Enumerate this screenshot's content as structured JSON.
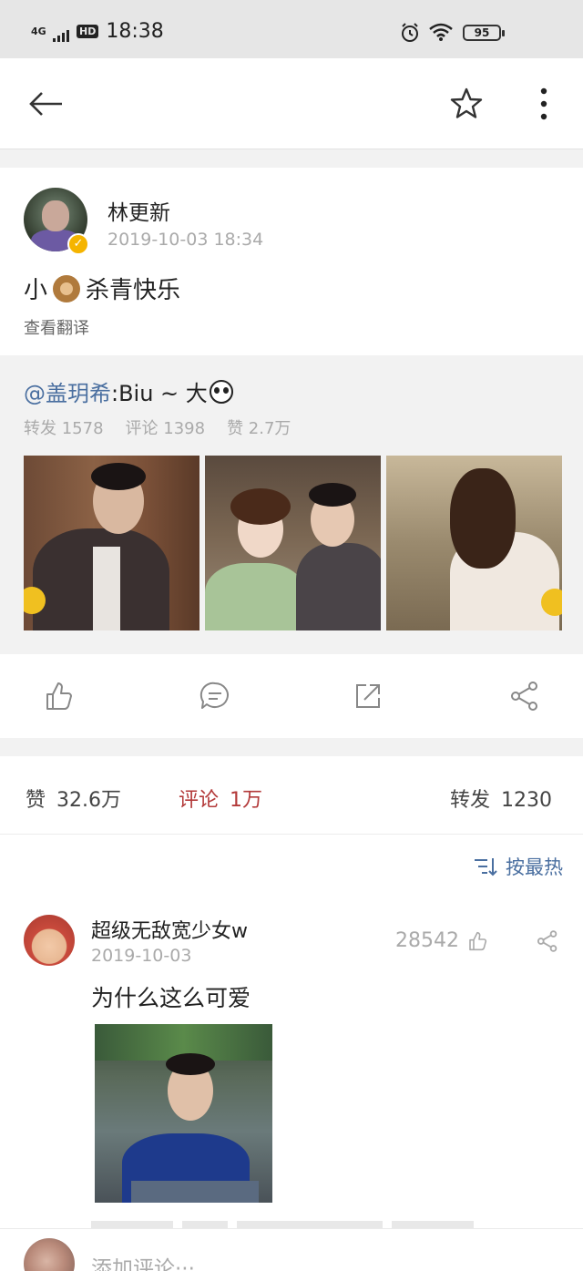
{
  "status_bar": {
    "network": "4G",
    "hd": "HD",
    "time": "18:38",
    "battery": "95"
  },
  "nav": {
    "back_icon": "arrow-left-icon",
    "favorite_icon": "star-outline-icon",
    "more_icon": "more-vertical-icon"
  },
  "post": {
    "author": "林更新",
    "verified_badge": "✓",
    "timestamp": "2019-10-03 18:34",
    "text_before": "小",
    "emoji": "monkey-emoji",
    "text_after": "杀青快乐",
    "translate": "查看翻译"
  },
  "repost": {
    "mention": "@盖玥希",
    "text": " :Biu ~ 大",
    "emoji": "panda-emoji",
    "reposts": "转发 1578",
    "comments": "评论 1398",
    "likes": "赞 2.7万"
  },
  "actions": {
    "like_icon": "thumbs-up-icon",
    "comment_icon": "comment-icon",
    "repost_icon": "repost-icon",
    "share_icon": "share-icon"
  },
  "stats": {
    "likes_label": "赞",
    "likes_count": "32.6万",
    "comments_label": "评论",
    "comments_count": "1万",
    "reposts_label": "转发",
    "reposts_count": "1230"
  },
  "comments": {
    "sort_label": "按最热",
    "items": [
      {
        "username": "超级无敌宽少女w",
        "date": "2019-10-03",
        "likes": "28542",
        "text": "为什么这么可爱"
      }
    ]
  },
  "input": {
    "placeholder": "添加评论···"
  },
  "colors": {
    "link": "#4a6fa0",
    "active_tab": "#b33a3a",
    "muted": "#aaaaaa",
    "verified": "#f5b400"
  }
}
